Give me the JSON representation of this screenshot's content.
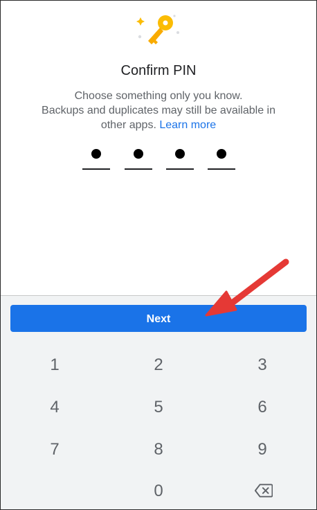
{
  "header": {
    "icon": "key-icon",
    "title": "Confirm PIN",
    "description_line1": "Choose something only you know.",
    "description_line2": "Backups and duplicates may still be available in",
    "description_line3": "other apps.",
    "learn_more": "Learn more"
  },
  "pin": {
    "entered_count": 4,
    "total_count": 4
  },
  "actions": {
    "next_label": "Next"
  },
  "keypad": {
    "keys": [
      "1",
      "2",
      "3",
      "4",
      "5",
      "6",
      "7",
      "8",
      "9",
      "0"
    ],
    "backspace_icon": "backspace-icon"
  },
  "colors": {
    "accent": "#1a73e8",
    "key_gold": "#fbbc04",
    "annotation_arrow": "#e53935"
  }
}
